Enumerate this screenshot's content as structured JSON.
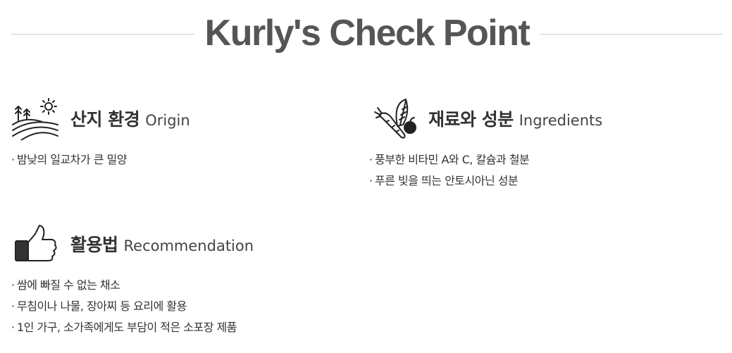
{
  "title": "Kurly's Check Point",
  "sections": [
    {
      "title": "산지 환경",
      "subtitle": "Origin",
      "icon": "field-sun-icon",
      "items": [
        "밤낮의 일교차가 큰 밀양"
      ]
    },
    {
      "title": "재료와 성분",
      "subtitle": "Ingredients",
      "icon": "carrot-beet-icon",
      "items": [
        "풍부한 비타민 A와 C, 칼슘과 철분",
        "푸른 빛을 띄는 안토시아닌 성분"
      ]
    },
    {
      "title": "활용법",
      "subtitle": "Recommendation",
      "icon": "thumbs-up-icon",
      "items": [
        "쌈에 빠질 수 없는 채소",
        "무침이나 나물, 장아찌 등 요리에 활용",
        "1인 가구, 소가족에게도 부담이 적은 소포장 제품"
      ]
    }
  ],
  "bullet_char": "·"
}
